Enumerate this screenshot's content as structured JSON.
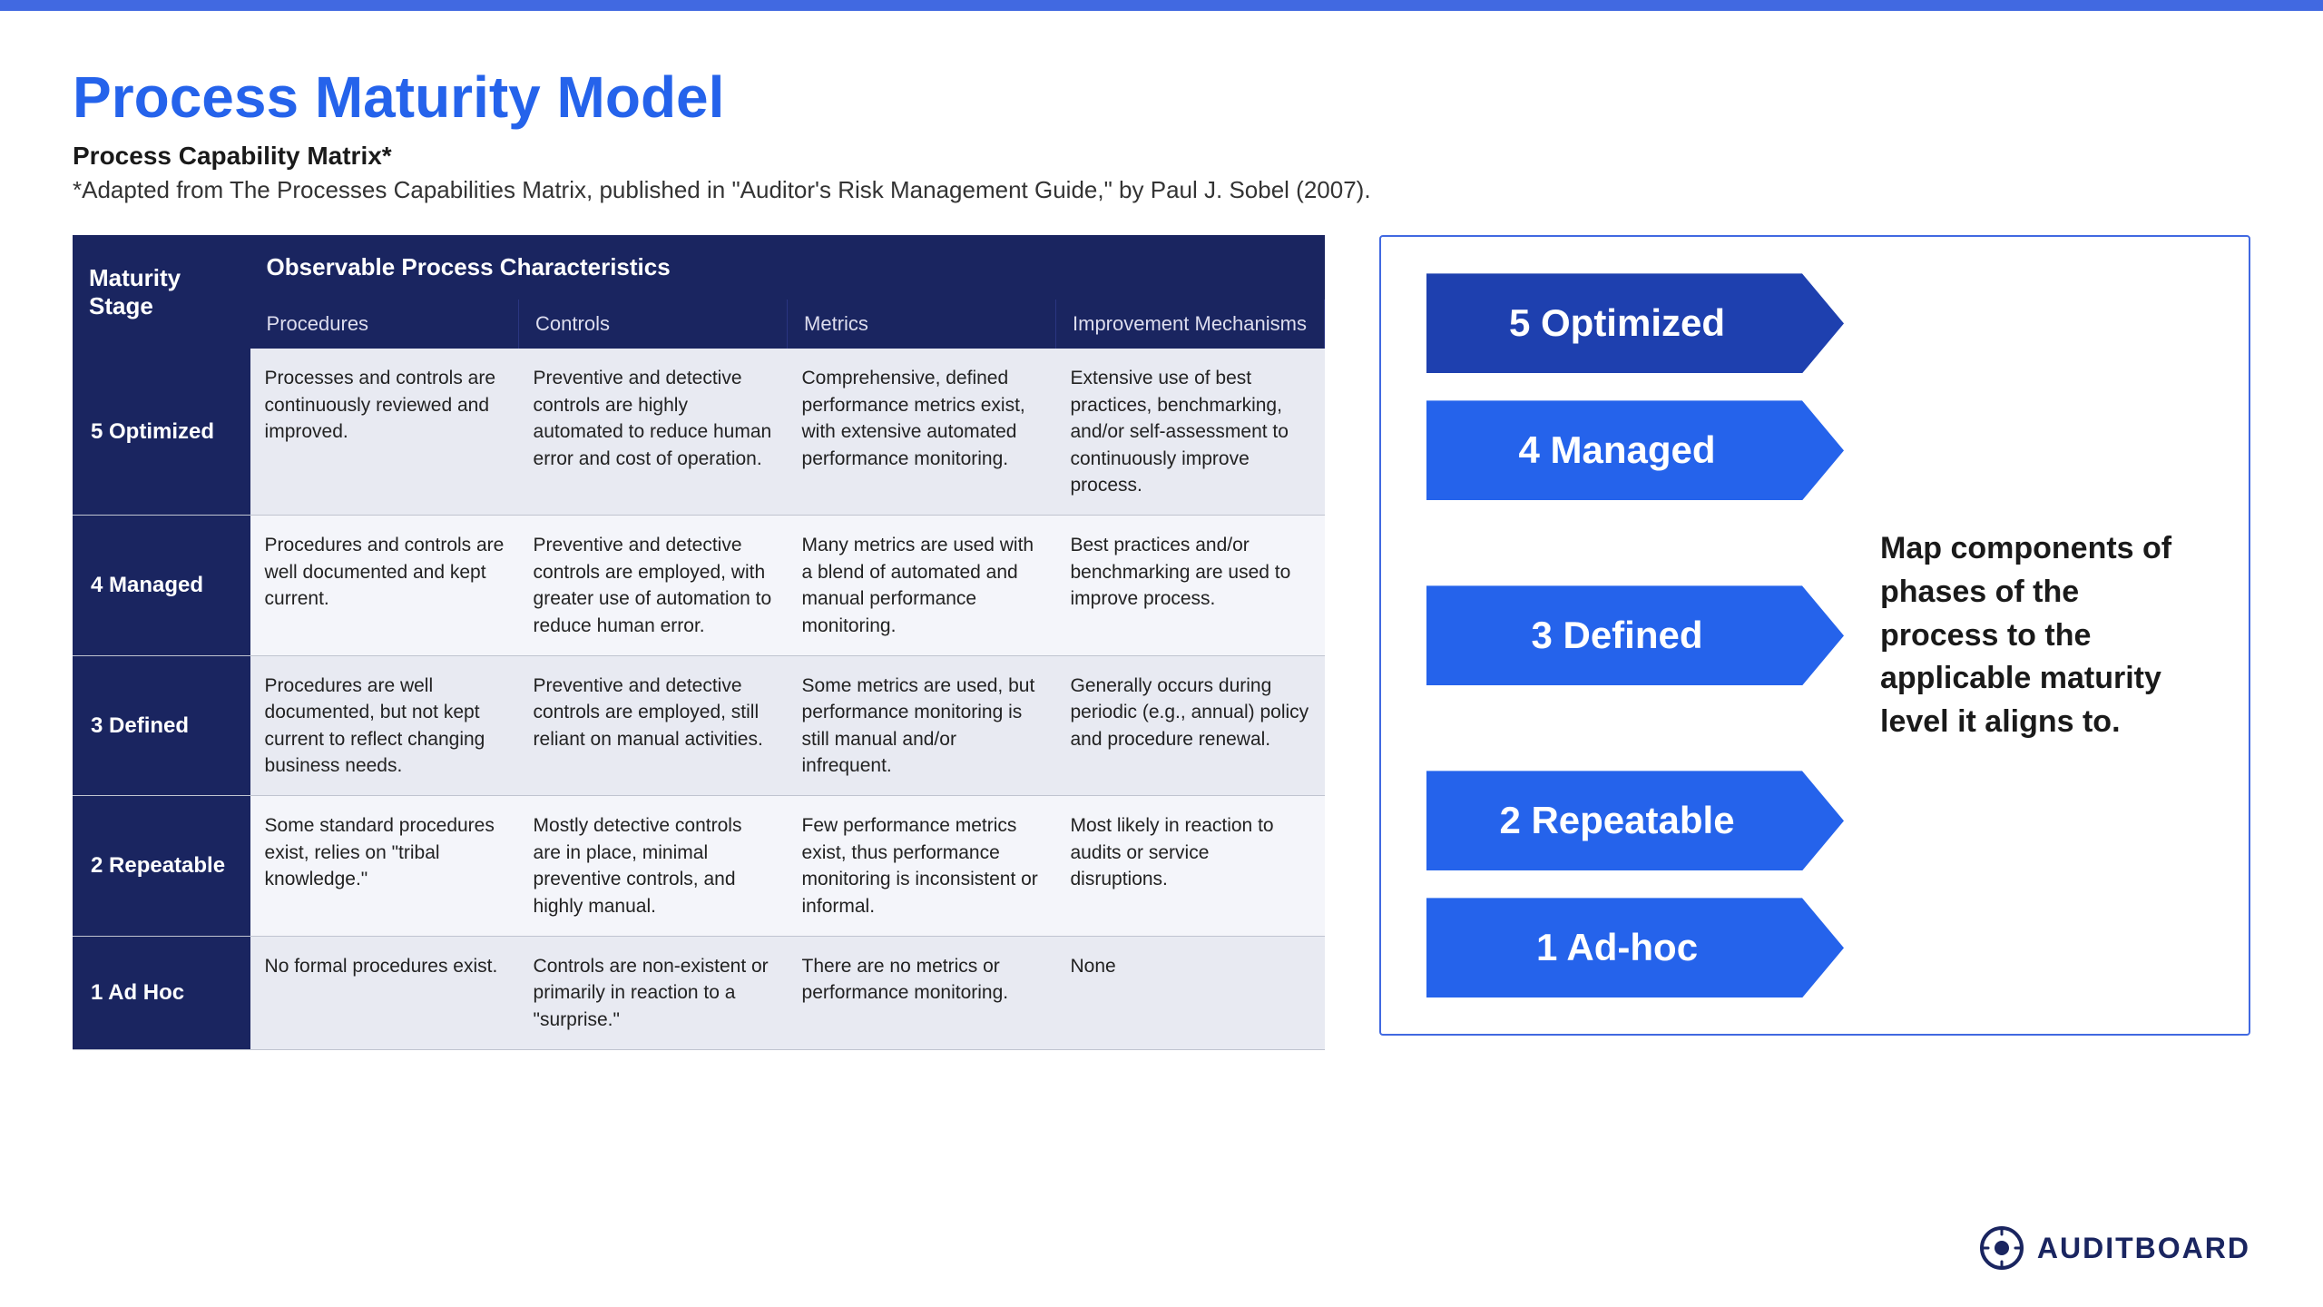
{
  "topBar": {},
  "header": {
    "title": "Process Maturity Model",
    "subtitleBold": "Process Capability Matrix*",
    "subtitleNormal": "*Adapted from The Processes Capabilities Matrix, published in \"Auditor's Risk Management Guide,\" by Paul J. Sobel (2007)."
  },
  "table": {
    "headerSpan": "Observable Process Characteristics",
    "maturityLabel": "Maturity Stage",
    "columns": [
      "Procedures",
      "Controls",
      "Metrics",
      "Improvement Mechanisms"
    ],
    "rows": [
      {
        "stage": "5 Optimized",
        "procedures": "Processes and controls are continuously reviewed and improved.",
        "controls": "Preventive and detective controls are highly automated to reduce human error and cost of operation.",
        "metrics": "Comprehensive, defined performance metrics exist, with extensive automated performance monitoring.",
        "improvement": "Extensive use of best practices, benchmarking, and/or self-assessment to continuously improve process."
      },
      {
        "stage": "4 Managed",
        "procedures": "Procedures and controls are well documented and kept current.",
        "controls": "Preventive and detective controls are employed, with greater use of automation to reduce human error.",
        "metrics": "Many metrics are used with a blend of automated and manual performance monitoring.",
        "improvement": "Best practices and/or benchmarking are used to improve process."
      },
      {
        "stage": "3 Defined",
        "procedures": "Procedures are well documented, but not kept current to reflect changing business needs.",
        "controls": "Preventive and detective controls are employed, still reliant on manual activities.",
        "metrics": "Some metrics are used, but performance monitoring is still manual and/or infrequent.",
        "improvement": "Generally occurs during periodic (e.g., annual) policy and procedure renewal."
      },
      {
        "stage": "2 Repeatable",
        "procedures": "Some standard procedures exist, relies on \"tribal knowledge.\"",
        "controls": "Mostly detective controls are in place, minimal preventive controls, and highly manual.",
        "metrics": "Few performance metrics exist, thus performance monitoring is inconsistent or informal.",
        "improvement": "Most likely in reaction to audits or service disruptions."
      },
      {
        "stage": "1 Ad Hoc",
        "procedures": "No formal procedures exist.",
        "controls": "Controls are non-existent or primarily in reaction to a \"surprise.\"",
        "metrics": "There are no metrics or performance monitoring.",
        "improvement": "None"
      }
    ]
  },
  "rightPanel": {
    "levels": [
      {
        "label": "5 Optimized",
        "level": "level5"
      },
      {
        "label": "4 Managed",
        "level": "level4"
      },
      {
        "label": "3 Defined",
        "level": "level3"
      },
      {
        "label": "2 Repeatable",
        "level": "level2"
      },
      {
        "label": "1 Ad-hoc",
        "level": "level1"
      }
    ],
    "mapText": "Map components of phases of the process to the applicable maturity level it aligns to.",
    "mapTextPosition": "level3"
  },
  "logo": {
    "text": "AUDITBOARD"
  }
}
